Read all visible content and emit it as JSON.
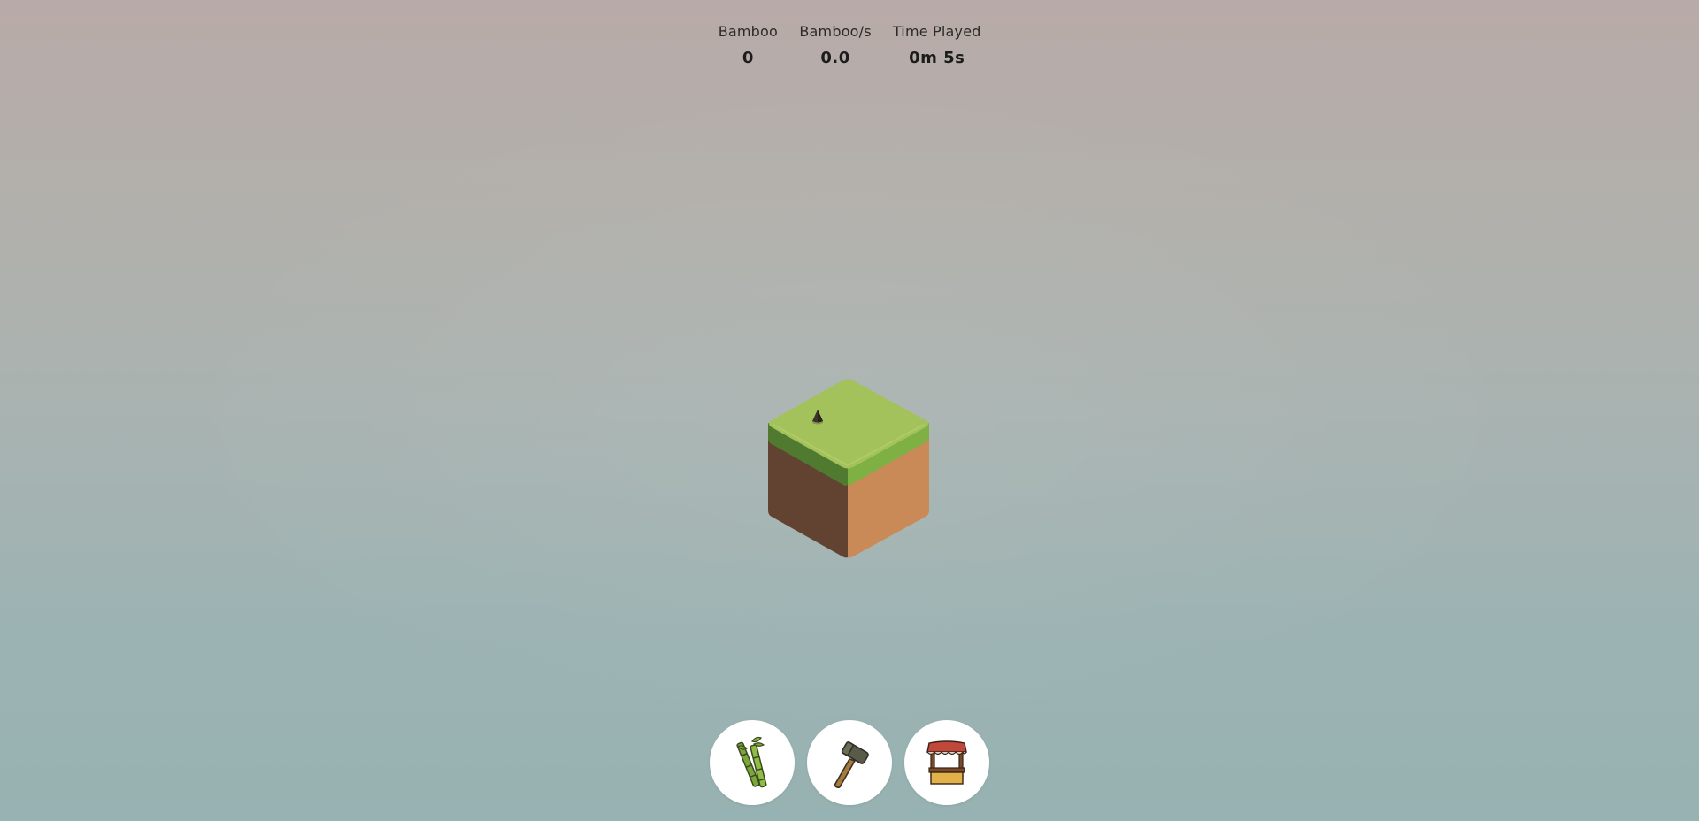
{
  "hud": {
    "bamboo": {
      "label": "Bamboo",
      "value": "0"
    },
    "rate": {
      "label": "Bamboo/s",
      "value": "0.0"
    },
    "time": {
      "label": "Time Played",
      "value": "0m 5s"
    }
  },
  "scene": {
    "block": "grass-dirt-block",
    "sprout_icon": "seed-sprout-icon"
  },
  "toolbar": {
    "buttons": [
      {
        "name": "bamboo",
        "icon": "bamboo-icon"
      },
      {
        "name": "build",
        "icon": "hammer-icon"
      },
      {
        "name": "shop",
        "icon": "market-stall-icon"
      }
    ]
  },
  "colors": {
    "grass_top": "#a3c25c",
    "grass_side_left": "#4f7a30",
    "grass_side_right": "#7fb043",
    "dirt_left": "#624332",
    "dirt_right": "#c98a58",
    "button_bg": "#ffffff"
  }
}
